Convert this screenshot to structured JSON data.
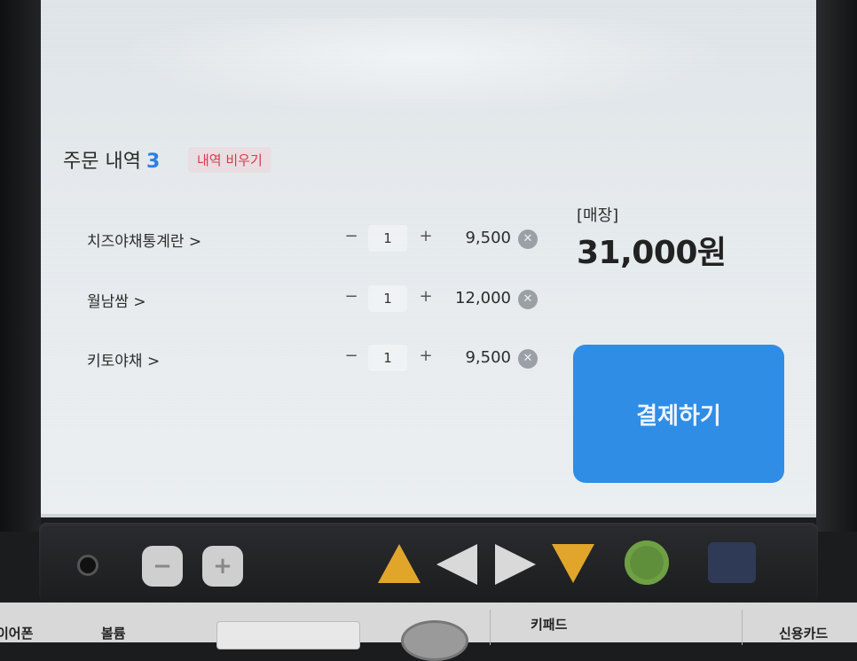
{
  "order": {
    "title": "주문 내역",
    "count": "3",
    "clear_label": "내역 비우기"
  },
  "items": [
    {
      "name": "치즈야채통계란 >",
      "qty": "1",
      "price": "9,500"
    },
    {
      "name": "월남쌈 >",
      "qty": "1",
      "price": "12,000"
    },
    {
      "name": "키토야채 >",
      "qty": "1",
      "price": "9,500"
    }
  ],
  "controls": {
    "minus": "−",
    "plus": "+",
    "remove": "✕"
  },
  "summary": {
    "dine_option": "[매장]",
    "total": "31,000원"
  },
  "pay_label": "결제하기",
  "hardware": {
    "vol_down": "−",
    "vol_up": "+"
  },
  "strip": {
    "earphone_label": "이어폰",
    "volume_label": "볼륨",
    "keypad_label": "키패드",
    "card_label": "신용카드"
  },
  "colors": {
    "accent": "#2f8de6",
    "count": "#2e7ee0",
    "clear_text": "#d8394d",
    "arrow_up": "#e0a52a",
    "arrow_down": "#e0a52a",
    "arrow_side": "#d9d9d9",
    "ok": "#5f8f3a",
    "square": "#2f3a56"
  }
}
